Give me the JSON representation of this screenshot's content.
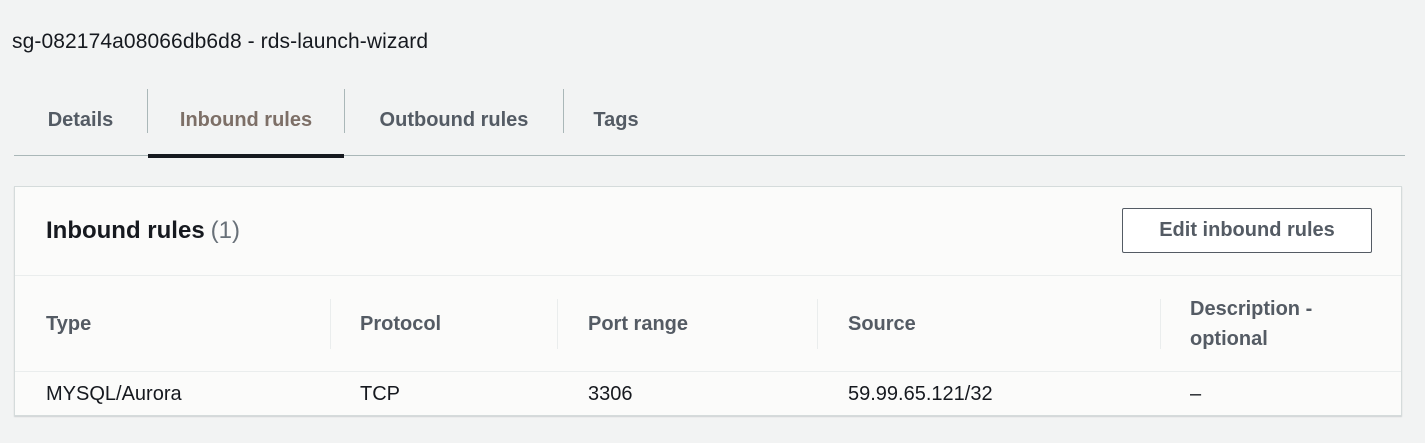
{
  "security_group": {
    "title": "sg-082174a08066db6d8 - rds-launch-wizard"
  },
  "tabs": [
    {
      "label": "Details",
      "active": false
    },
    {
      "label": "Inbound rules",
      "active": true
    },
    {
      "label": "Outbound rules",
      "active": false
    },
    {
      "label": "Tags",
      "active": false
    }
  ],
  "panel": {
    "title": "Inbound rules",
    "count": "(1)",
    "edit_button_label": "Edit inbound rules"
  },
  "table": {
    "columns": [
      "Type",
      "Protocol",
      "Port range",
      "Source",
      "Description - optional"
    ],
    "rows": [
      [
        "MYSQL/Aurora",
        "TCP",
        "3306",
        "59.99.65.121/32",
        "–"
      ]
    ]
  },
  "colors": {
    "active_tab_text": "#7d6f67",
    "active_tab_underline": "#16191f",
    "background": "#f2f3f3"
  }
}
